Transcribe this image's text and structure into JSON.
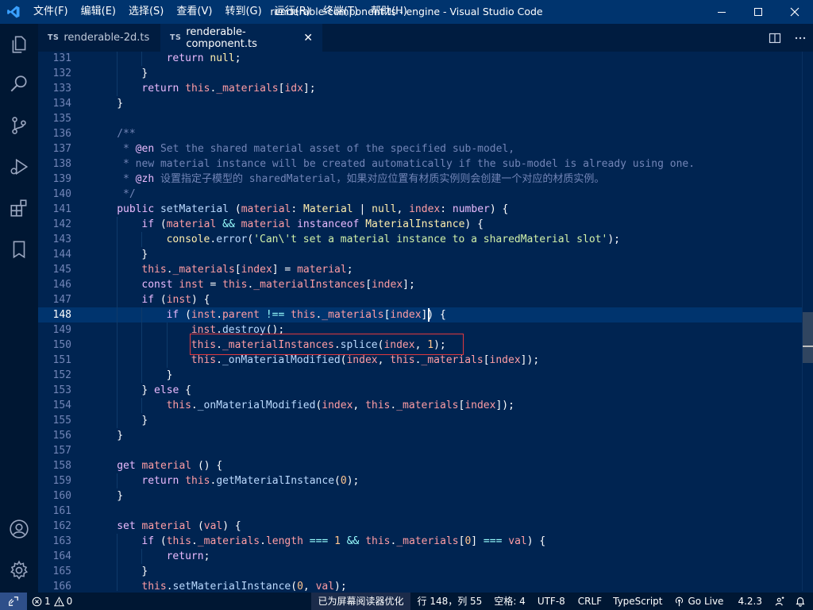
{
  "titlebar": {
    "menus": [
      "文件(F)",
      "编辑(E)",
      "选择(S)",
      "查看(V)",
      "转到(G)",
      "运行(R)",
      "终端(T)",
      "帮助(H)"
    ],
    "title": "renderable-component.ts - engine - Visual Studio Code"
  },
  "activitybar": {
    "icons": [
      "files-icon",
      "search-icon",
      "source-control-icon",
      "run-debug-icon",
      "extensions-icon",
      "bookmark-icon",
      "account-icon",
      "settings-gear-icon"
    ]
  },
  "tabs": [
    {
      "badge": "TS",
      "label": "renderable-2d.ts",
      "active": false
    },
    {
      "badge": "TS",
      "label": "renderable-component.ts",
      "active": true,
      "close": "✕"
    }
  ],
  "editor": {
    "current_line": 148,
    "lines": [
      {
        "n": "131",
        "indent": 3,
        "t": [
          [
            "kw",
            "return "
          ],
          [
            "type",
            "null"
          ],
          [
            "p",
            ";"
          ]
        ]
      },
      {
        "n": "132",
        "indent": 2,
        "t": [
          [
            "p",
            "}"
          ]
        ]
      },
      {
        "n": "133",
        "indent": 2,
        "t": [
          [
            "kw",
            "return "
          ],
          [
            "this",
            "this"
          ],
          [
            "p",
            "."
          ],
          [
            "prop",
            "_materials"
          ],
          [
            "p",
            "["
          ],
          [
            "prop",
            "idx"
          ],
          [
            "p",
            "];"
          ]
        ]
      },
      {
        "n": "134",
        "indent": 1,
        "t": [
          [
            "p",
            "}"
          ]
        ]
      },
      {
        "n": "135",
        "indent": 0,
        "t": []
      },
      {
        "n": "136",
        "indent": 1,
        "t": [
          [
            "com",
            "/**"
          ]
        ]
      },
      {
        "n": "137",
        "indent": 1,
        "t": [
          [
            "com",
            " * "
          ],
          [
            "tag",
            "@en"
          ],
          [
            "com",
            " Set the shared material asset of the specified sub-model,"
          ]
        ]
      },
      {
        "n": "138",
        "indent": 1,
        "t": [
          [
            "com",
            " * new material instance will be created automatically if the sub-model is already using one."
          ]
        ]
      },
      {
        "n": "139",
        "indent": 1,
        "t": [
          [
            "com",
            " * "
          ],
          [
            "tag",
            "@zh"
          ],
          [
            "com",
            " 设置指定子模型的 sharedMaterial，如果对应位置有材质实例则会创建一个对应的材质实例。"
          ]
        ]
      },
      {
        "n": "140",
        "indent": 1,
        "t": [
          [
            "com",
            " */"
          ]
        ]
      },
      {
        "n": "141",
        "indent": 1,
        "t": [
          [
            "kw",
            "public "
          ],
          [
            "fn",
            "setMaterial"
          ],
          [
            "p",
            " ("
          ],
          [
            "prop",
            "material"
          ],
          [
            "p",
            ": "
          ],
          [
            "type",
            "Material"
          ],
          [
            "p",
            " | "
          ],
          [
            "type",
            "null"
          ],
          [
            "p",
            ", "
          ],
          [
            "prop",
            "index"
          ],
          [
            "p",
            ": "
          ],
          [
            "kw",
            "number"
          ],
          [
            "p",
            ") {"
          ]
        ]
      },
      {
        "n": "142",
        "indent": 2,
        "t": [
          [
            "kw",
            "if"
          ],
          [
            "p",
            " ("
          ],
          [
            "prop",
            "material"
          ],
          [
            "op",
            " && "
          ],
          [
            "prop",
            "material"
          ],
          [
            "kw",
            " instanceof "
          ],
          [
            "type",
            "MaterialInstance"
          ],
          [
            "p",
            ") {"
          ]
        ]
      },
      {
        "n": "143",
        "indent": 3,
        "t": [
          [
            "type",
            "console"
          ],
          [
            "p",
            "."
          ],
          [
            "fn",
            "error"
          ],
          [
            "p",
            "("
          ],
          [
            "str",
            "'Can\\'t set a material instance to a sharedMaterial slot'"
          ],
          [
            "p",
            ");"
          ]
        ]
      },
      {
        "n": "144",
        "indent": 2,
        "t": [
          [
            "p",
            "}"
          ]
        ]
      },
      {
        "n": "145",
        "indent": 2,
        "t": [
          [
            "this",
            "this"
          ],
          [
            "p",
            "."
          ],
          [
            "prop",
            "_materials"
          ],
          [
            "p",
            "["
          ],
          [
            "prop",
            "index"
          ],
          [
            "p",
            "] = "
          ],
          [
            "prop",
            "material"
          ],
          [
            "p",
            ";"
          ]
        ]
      },
      {
        "n": "146",
        "indent": 2,
        "t": [
          [
            "kw",
            "const "
          ],
          [
            "prop",
            "inst"
          ],
          [
            "p",
            " = "
          ],
          [
            "this",
            "this"
          ],
          [
            "p",
            "."
          ],
          [
            "prop",
            "_materialInstances"
          ],
          [
            "p",
            "["
          ],
          [
            "prop",
            "index"
          ],
          [
            "p",
            "];"
          ]
        ]
      },
      {
        "n": "147",
        "indent": 2,
        "t": [
          [
            "kw",
            "if"
          ],
          [
            "p",
            " ("
          ],
          [
            "prop",
            "inst"
          ],
          [
            "p",
            ") {"
          ]
        ]
      },
      {
        "n": "148",
        "indent": 3,
        "t": [
          [
            "kw",
            "if"
          ],
          [
            "p",
            " ("
          ],
          [
            "prop",
            "inst"
          ],
          [
            "p",
            "."
          ],
          [
            "prop",
            "parent"
          ],
          [
            "op",
            " !== "
          ],
          [
            "this",
            "this"
          ],
          [
            "p",
            "."
          ],
          [
            "prop",
            "_materials"
          ],
          [
            "p",
            "["
          ],
          [
            "prop",
            "index"
          ],
          [
            "p",
            "]) {"
          ]
        ]
      },
      {
        "n": "149",
        "indent": 4,
        "t": [
          [
            "prop",
            "inst"
          ],
          [
            "p",
            "."
          ],
          [
            "fn",
            "destroy"
          ],
          [
            "p",
            "();"
          ]
        ]
      },
      {
        "n": "150",
        "indent": 4,
        "t": [
          [
            "this",
            "this"
          ],
          [
            "p",
            "."
          ],
          [
            "prop",
            "_materialInstances"
          ],
          [
            "p",
            "."
          ],
          [
            "fn",
            "splice"
          ],
          [
            "p",
            "("
          ],
          [
            "prop",
            "index"
          ],
          [
            "p",
            ", "
          ],
          [
            "num",
            "1"
          ],
          [
            "p",
            ");"
          ]
        ]
      },
      {
        "n": "151",
        "indent": 4,
        "t": [
          [
            "this",
            "this"
          ],
          [
            "p",
            "."
          ],
          [
            "fn",
            "_onMaterialModified"
          ],
          [
            "p",
            "("
          ],
          [
            "prop",
            "index"
          ],
          [
            "p",
            ", "
          ],
          [
            "this",
            "this"
          ],
          [
            "p",
            "."
          ],
          [
            "prop",
            "_materials"
          ],
          [
            "p",
            "["
          ],
          [
            "prop",
            "index"
          ],
          [
            "p",
            "]);"
          ]
        ]
      },
      {
        "n": "152",
        "indent": 3,
        "t": [
          [
            "p",
            "}"
          ]
        ]
      },
      {
        "n": "153",
        "indent": 2,
        "t": [
          [
            "p",
            "} "
          ],
          [
            "kw",
            "else"
          ],
          [
            "p",
            " {"
          ]
        ]
      },
      {
        "n": "154",
        "indent": 3,
        "t": [
          [
            "this",
            "this"
          ],
          [
            "p",
            "."
          ],
          [
            "fn",
            "_onMaterialModified"
          ],
          [
            "p",
            "("
          ],
          [
            "prop",
            "index"
          ],
          [
            "p",
            ", "
          ],
          [
            "this",
            "this"
          ],
          [
            "p",
            "."
          ],
          [
            "prop",
            "_materials"
          ],
          [
            "p",
            "["
          ],
          [
            "prop",
            "index"
          ],
          [
            "p",
            "]);"
          ]
        ]
      },
      {
        "n": "155",
        "indent": 2,
        "t": [
          [
            "p",
            "}"
          ]
        ]
      },
      {
        "n": "156",
        "indent": 1,
        "t": [
          [
            "p",
            "}"
          ]
        ]
      },
      {
        "n": "157",
        "indent": 0,
        "t": []
      },
      {
        "n": "158",
        "indent": 1,
        "t": [
          [
            "kw",
            "get "
          ],
          [
            "prop",
            "material"
          ],
          [
            "p",
            " () {"
          ]
        ]
      },
      {
        "n": "159",
        "indent": 2,
        "t": [
          [
            "kw",
            "return "
          ],
          [
            "this",
            "this"
          ],
          [
            "p",
            "."
          ],
          [
            "fn",
            "getMaterialInstance"
          ],
          [
            "p",
            "("
          ],
          [
            "num",
            "0"
          ],
          [
            "p",
            ");"
          ]
        ]
      },
      {
        "n": "160",
        "indent": 1,
        "t": [
          [
            "p",
            "}"
          ]
        ]
      },
      {
        "n": "161",
        "indent": 0,
        "t": []
      },
      {
        "n": "162",
        "indent": 1,
        "t": [
          [
            "kw",
            "set "
          ],
          [
            "prop",
            "material"
          ],
          [
            "p",
            " ("
          ],
          [
            "prop",
            "val"
          ],
          [
            "p",
            ") {"
          ]
        ]
      },
      {
        "n": "163",
        "indent": 2,
        "t": [
          [
            "kw",
            "if"
          ],
          [
            "p",
            " ("
          ],
          [
            "this",
            "this"
          ],
          [
            "p",
            "."
          ],
          [
            "prop",
            "_materials"
          ],
          [
            "p",
            "."
          ],
          [
            "prop",
            "length"
          ],
          [
            "op",
            " === "
          ],
          [
            "num",
            "1"
          ],
          [
            "op",
            " && "
          ],
          [
            "this",
            "this"
          ],
          [
            "p",
            "."
          ],
          [
            "prop",
            "_materials"
          ],
          [
            "p",
            "["
          ],
          [
            "num",
            "0"
          ],
          [
            "p",
            "]"
          ],
          [
            "op",
            " === "
          ],
          [
            "prop",
            "val"
          ],
          [
            "p",
            ") {"
          ]
        ]
      },
      {
        "n": "164",
        "indent": 3,
        "t": [
          [
            "kw",
            "return"
          ],
          [
            "p",
            ";"
          ]
        ]
      },
      {
        "n": "165",
        "indent": 2,
        "t": [
          [
            "p",
            "}"
          ]
        ]
      },
      {
        "n": "166",
        "indent": 2,
        "t": [
          [
            "this",
            "this"
          ],
          [
            "p",
            "."
          ],
          [
            "fn",
            "setMaterialInstance"
          ],
          [
            "p",
            "("
          ],
          [
            "num",
            "0"
          ],
          [
            "p",
            ", "
          ],
          [
            "prop",
            "val"
          ],
          [
            "p",
            ");"
          ]
        ]
      }
    ]
  },
  "statusbar": {
    "problems_errors": "0 1",
    "problems_warnings": "0",
    "screen_reader": "已为屏幕阅读器优化",
    "position": "行 148，列 55",
    "spaces": "空格: 4",
    "encoding": "UTF-8",
    "eol": "CRLF",
    "language": "TypeScript",
    "golive": "Go Live",
    "version": "4.2.3"
  }
}
